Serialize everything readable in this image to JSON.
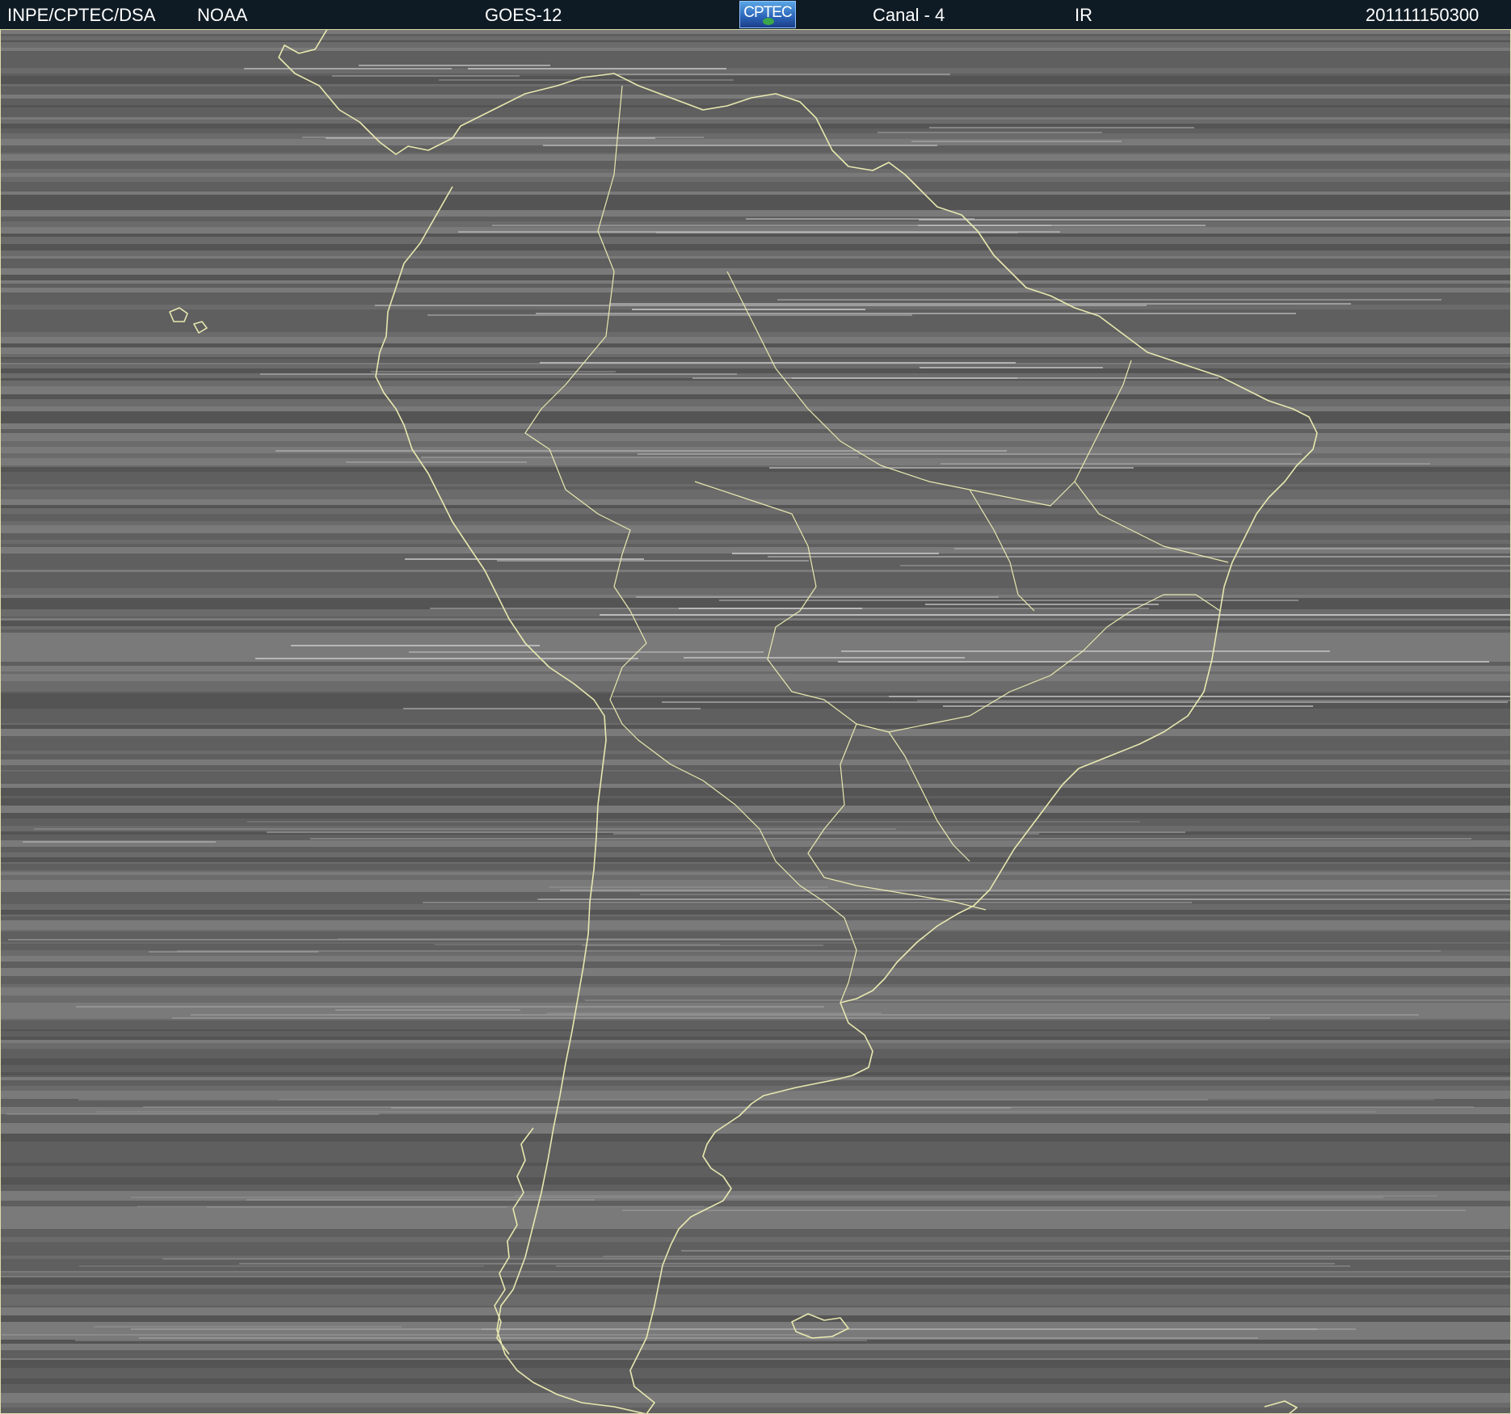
{
  "header": {
    "institution": "INPE/CPTEC/DSA",
    "agency": "NOAA",
    "satellite": "GOES-12",
    "logo_text": "CPTEC",
    "channel": "Canal - 4",
    "band": "IR",
    "timestamp": "201111150300"
  },
  "imagery": {
    "description_icon": "satellite-infrared-image",
    "background_color": "#7a7a7a",
    "coastline_color": "#e8e8b0",
    "cloud_color": "#e6e6e6"
  }
}
